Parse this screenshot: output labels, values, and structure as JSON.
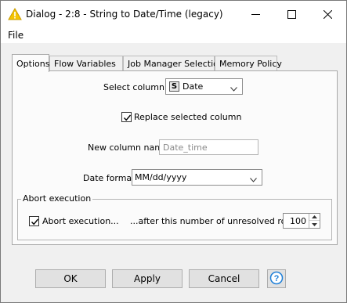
{
  "window": {
    "title": "Dialog - 2:8 - String to Date/Time (legacy)",
    "icon": "warning-triangle-icon",
    "controls": [
      "minimize-icon",
      "maximize-icon",
      "close-icon"
    ]
  },
  "menu": {
    "file_label": "File"
  },
  "tabs": [
    {
      "label": "Options",
      "active": true
    },
    {
      "label": "Flow Variables",
      "active": false
    },
    {
      "label": "Job Manager Selection",
      "active": false
    },
    {
      "label": "Memory Policy",
      "active": false
    }
  ],
  "options": {
    "select_column_label": "Select column:",
    "column_type_badge": "S",
    "selected_column": "Date",
    "replace_label": "Replace selected column",
    "replace_checked": true,
    "new_column_label": "New column name",
    "new_column_value": "Date_time",
    "date_format_label": "Date format",
    "date_format_value": "MM/dd/yyyy",
    "abort_group_title": "Abort execution",
    "abort_label": "Abort execution...",
    "abort_checked": true,
    "rows_label": "...after this number of unresolved rows",
    "rows_value": "100"
  },
  "buttons": {
    "ok": "OK",
    "apply": "Apply",
    "cancel": "Cancel",
    "help_icon": "help-icon"
  },
  "colors": {
    "warning_yellow": "#f5c400",
    "help_blue": "#1e7fd8"
  }
}
